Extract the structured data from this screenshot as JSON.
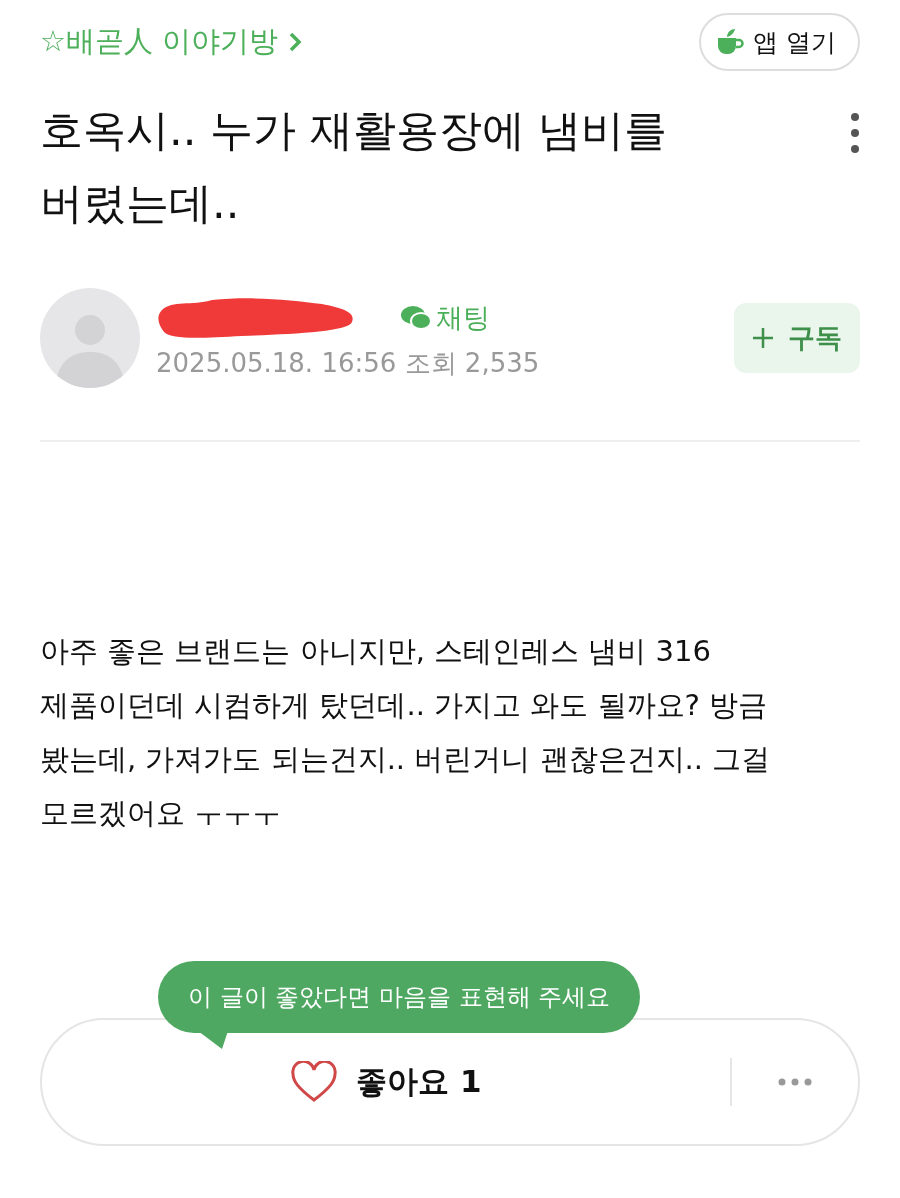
{
  "header": {
    "cafe_link": "☆배곧人 이야기방",
    "open_app_button": "앱 열기"
  },
  "post": {
    "title": "호옥시.. 누가 재활용장에 냄비를 버렸는데..",
    "author": {
      "chat_link": "채팅",
      "date": "2025.05.18. 16:56",
      "views": "조회 2,535",
      "subscribe_button": "구독"
    },
    "body": "아주 좋은 브랜드는 아니지만, 스테인레스 냄비 316 제품이던데 시컴하게 탔던데.. 가지고 와도 될까요? 방금 봤는데, 가져가도 되는건지.. 버린거니 괜찮은건지.. 그걸 모르겠어요 ㅜㅜㅜ"
  },
  "reaction_bar": {
    "tooltip": "이 글이 좋았다면 마음을 표현해 주세요",
    "like_button": "좋아요 1",
    "liked": false
  }
}
